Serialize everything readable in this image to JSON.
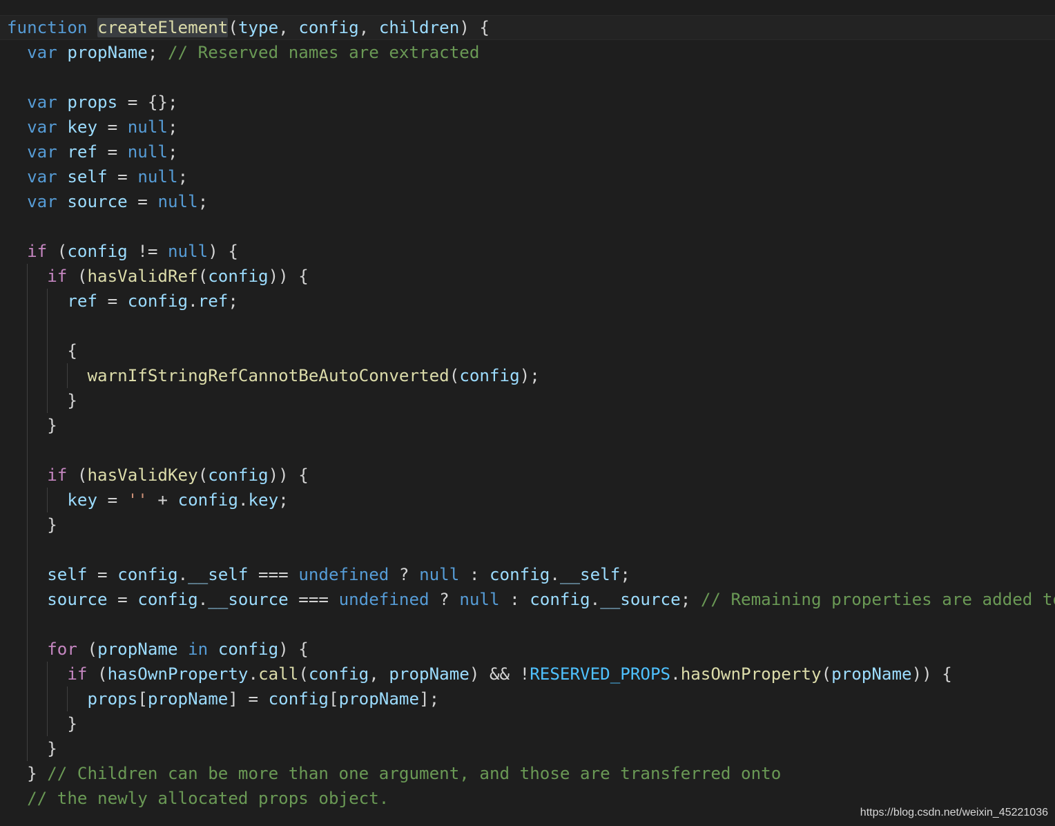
{
  "editor": {
    "lines": [
      [
        [
          "kw",
          "function"
        ],
        [
          "p",
          " "
        ],
        [
          "fn",
          "createElement",
          "hl"
        ],
        [
          "p",
          "("
        ],
        [
          "var",
          "type"
        ],
        [
          "p",
          ", "
        ],
        [
          "var",
          "config"
        ],
        [
          "p",
          ", "
        ],
        [
          "var",
          "children"
        ],
        [
          "p",
          ") {"
        ]
      ],
      [
        [
          "p",
          "  "
        ],
        [
          "kw",
          "var"
        ],
        [
          "p",
          " "
        ],
        [
          "var",
          "propName"
        ],
        [
          "p",
          "; "
        ],
        [
          "cm",
          "// Reserved names are extracted"
        ]
      ],
      [],
      [
        [
          "p",
          "  "
        ],
        [
          "kw",
          "var"
        ],
        [
          "p",
          " "
        ],
        [
          "var",
          "props"
        ],
        [
          "p",
          " = {};"
        ]
      ],
      [
        [
          "p",
          "  "
        ],
        [
          "kw",
          "var"
        ],
        [
          "p",
          " "
        ],
        [
          "var",
          "key"
        ],
        [
          "p",
          " = "
        ],
        [
          "kw",
          "null"
        ],
        [
          "p",
          ";"
        ]
      ],
      [
        [
          "p",
          "  "
        ],
        [
          "kw",
          "var"
        ],
        [
          "p",
          " "
        ],
        [
          "var",
          "ref"
        ],
        [
          "p",
          " = "
        ],
        [
          "kw",
          "null"
        ],
        [
          "p",
          ";"
        ]
      ],
      [
        [
          "p",
          "  "
        ],
        [
          "kw",
          "var"
        ],
        [
          "p",
          " "
        ],
        [
          "var",
          "self"
        ],
        [
          "p",
          " = "
        ],
        [
          "kw",
          "null"
        ],
        [
          "p",
          ";"
        ]
      ],
      [
        [
          "p",
          "  "
        ],
        [
          "kw",
          "var"
        ],
        [
          "p",
          " "
        ],
        [
          "var",
          "source"
        ],
        [
          "p",
          " = "
        ],
        [
          "kw",
          "null"
        ],
        [
          "p",
          ";"
        ]
      ],
      [],
      [
        [
          "p",
          "  "
        ],
        [
          "ctl",
          "if"
        ],
        [
          "p",
          " ("
        ],
        [
          "var",
          "config"
        ],
        [
          "p",
          " != "
        ],
        [
          "kw",
          "null"
        ],
        [
          "p",
          ") {"
        ]
      ],
      [
        [
          "p",
          "    "
        ],
        [
          "ctl",
          "if"
        ],
        [
          "p",
          " ("
        ],
        [
          "fn",
          "hasValidRef"
        ],
        [
          "p",
          "("
        ],
        [
          "var",
          "config"
        ],
        [
          "p",
          ")) {"
        ]
      ],
      [
        [
          "p",
          "      "
        ],
        [
          "var",
          "ref"
        ],
        [
          "p",
          " = "
        ],
        [
          "var",
          "config"
        ],
        [
          "p",
          "."
        ],
        [
          "var",
          "ref"
        ],
        [
          "p",
          ";"
        ]
      ],
      [],
      [
        [
          "p",
          "      {"
        ]
      ],
      [
        [
          "p",
          "        "
        ],
        [
          "fn",
          "warnIfStringRefCannotBeAutoConverted"
        ],
        [
          "p",
          "("
        ],
        [
          "var",
          "config"
        ],
        [
          "p",
          ");"
        ]
      ],
      [
        [
          "p",
          "      }"
        ]
      ],
      [
        [
          "p",
          "    }"
        ]
      ],
      [],
      [
        [
          "p",
          "    "
        ],
        [
          "ctl",
          "if"
        ],
        [
          "p",
          " ("
        ],
        [
          "fn",
          "hasValidKey"
        ],
        [
          "p",
          "("
        ],
        [
          "var",
          "config"
        ],
        [
          "p",
          ")) {"
        ]
      ],
      [
        [
          "p",
          "      "
        ],
        [
          "var",
          "key"
        ],
        [
          "p",
          " = "
        ],
        [
          "str",
          "''"
        ],
        [
          "p",
          " + "
        ],
        [
          "var",
          "config"
        ],
        [
          "p",
          "."
        ],
        [
          "var",
          "key"
        ],
        [
          "p",
          ";"
        ]
      ],
      [
        [
          "p",
          "    }"
        ]
      ],
      [],
      [
        [
          "p",
          "    "
        ],
        [
          "var",
          "self"
        ],
        [
          "p",
          " = "
        ],
        [
          "var",
          "config"
        ],
        [
          "p",
          "."
        ],
        [
          "var",
          "__self"
        ],
        [
          "p",
          " === "
        ],
        [
          "kw",
          "undefined"
        ],
        [
          "p",
          " ? "
        ],
        [
          "kw",
          "null"
        ],
        [
          "p",
          " : "
        ],
        [
          "var",
          "config"
        ],
        [
          "p",
          "."
        ],
        [
          "var",
          "__self"
        ],
        [
          "p",
          ";"
        ]
      ],
      [
        [
          "p",
          "    "
        ],
        [
          "var",
          "source"
        ],
        [
          "p",
          " = "
        ],
        [
          "var",
          "config"
        ],
        [
          "p",
          "."
        ],
        [
          "var",
          "__source"
        ],
        [
          "p",
          " === "
        ],
        [
          "kw",
          "undefined"
        ],
        [
          "p",
          " ? "
        ],
        [
          "kw",
          "null"
        ],
        [
          "p",
          " : "
        ],
        [
          "var",
          "config"
        ],
        [
          "p",
          "."
        ],
        [
          "var",
          "__source"
        ],
        [
          "p",
          "; "
        ],
        [
          "cm",
          "// Remaining properties are added to"
        ]
      ],
      [],
      [
        [
          "p",
          "    "
        ],
        [
          "ctl",
          "for"
        ],
        [
          "p",
          " ("
        ],
        [
          "var",
          "propName"
        ],
        [
          "p",
          " "
        ],
        [
          "kw",
          "in"
        ],
        [
          "p",
          " "
        ],
        [
          "var",
          "config"
        ],
        [
          "p",
          ") {"
        ]
      ],
      [
        [
          "p",
          "      "
        ],
        [
          "ctl",
          "if"
        ],
        [
          "p",
          " ("
        ],
        [
          "var",
          "hasOwnProperty"
        ],
        [
          "p",
          "."
        ],
        [
          "fn",
          "call"
        ],
        [
          "p",
          "("
        ],
        [
          "var",
          "config"
        ],
        [
          "p",
          ", "
        ],
        [
          "var",
          "propName"
        ],
        [
          "p",
          ") && !"
        ],
        [
          "num",
          "RESERVED_PROPS"
        ],
        [
          "p",
          "."
        ],
        [
          "fn",
          "hasOwnProperty"
        ],
        [
          "p",
          "("
        ],
        [
          "var",
          "propName"
        ],
        [
          "p",
          ")) {"
        ]
      ],
      [
        [
          "p",
          "        "
        ],
        [
          "var",
          "props"
        ],
        [
          "p",
          "["
        ],
        [
          "var",
          "propName"
        ],
        [
          "p",
          "] = "
        ],
        [
          "var",
          "config"
        ],
        [
          "p",
          "["
        ],
        [
          "var",
          "propName"
        ],
        [
          "p",
          "];"
        ]
      ],
      [
        [
          "p",
          "      }"
        ]
      ],
      [
        [
          "p",
          "    }"
        ]
      ],
      [
        [
          "p",
          "  } "
        ],
        [
          "cm",
          "// Children can be more than one argument, and those are transferred onto"
        ]
      ],
      [
        [
          "p",
          "  "
        ],
        [
          "cm",
          "// the newly allocated props object."
        ]
      ]
    ]
  },
  "watermark": "https://blog.csdn.net/weixin_45221036"
}
